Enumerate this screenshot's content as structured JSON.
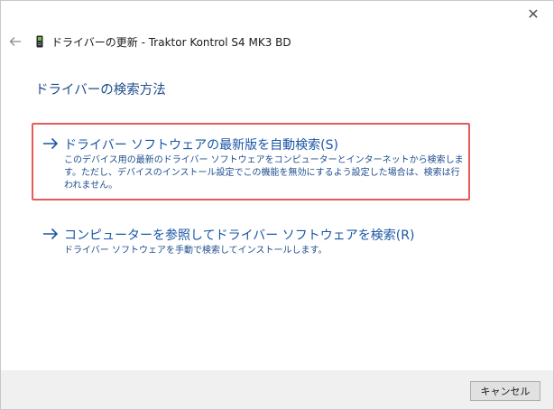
{
  "window": {
    "title": "ドライバーの更新 - Traktor Kontrol S4 MK3 BD",
    "close_glyph": "✕"
  },
  "page": {
    "heading": "ドライバーの検索方法"
  },
  "options": [
    {
      "title": "ドライバー ソフトウェアの最新版を自動検索(S)",
      "description": "このデバイス用の最新のドライバー ソフトウェアをコンピューターとインターネットから検索します。ただし、デバイスのインストール設定でこの機能を無効にするよう設定した場合は、検索は行われません。",
      "highlighted": true
    },
    {
      "title": "コンピューターを参照してドライバー ソフトウェアを検索(R)",
      "description": "ドライバー ソフトウェアを手動で検索してインストールします。",
      "highlighted": false
    }
  ],
  "footer": {
    "cancel_label": "キャンセル"
  },
  "icons": {
    "back": "back-arrow-icon",
    "device": "device-icon",
    "option_arrow": "right-arrow-icon",
    "close": "close-icon"
  },
  "colors": {
    "link_blue": "#1a56a6",
    "heading_blue": "#1f4e8c",
    "highlight_red": "#e85a5a",
    "footer_bg": "#f0f0f0"
  }
}
